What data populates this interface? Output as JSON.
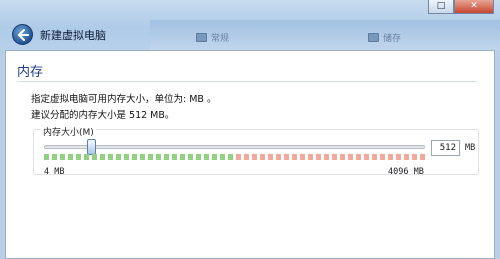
{
  "wizard": {
    "title": "新建虚拟电脑"
  },
  "background_tabs": [
    {
      "label": "常规",
      "icon": "settings-icon"
    },
    {
      "label": "储存",
      "icon": "storage-icon"
    }
  ],
  "window_controls": {
    "restore": "□",
    "close": "✕"
  },
  "section": {
    "title": "内存",
    "description": "指定虚拟电脑可用内存大小，单位为: MB 。",
    "recommendation": "建议分配的内存大小是 512 MB。"
  },
  "memory": {
    "group_label": "内存大小(M)",
    "value": "512",
    "unit": "MB",
    "min_label": "4 MB",
    "max_label": "4096 MB",
    "slider": {
      "min": 4,
      "max": 4096,
      "value": 512
    },
    "tick_colors": {
      "safe": "#8fd17f",
      "warning": "#f2a99b"
    }
  }
}
